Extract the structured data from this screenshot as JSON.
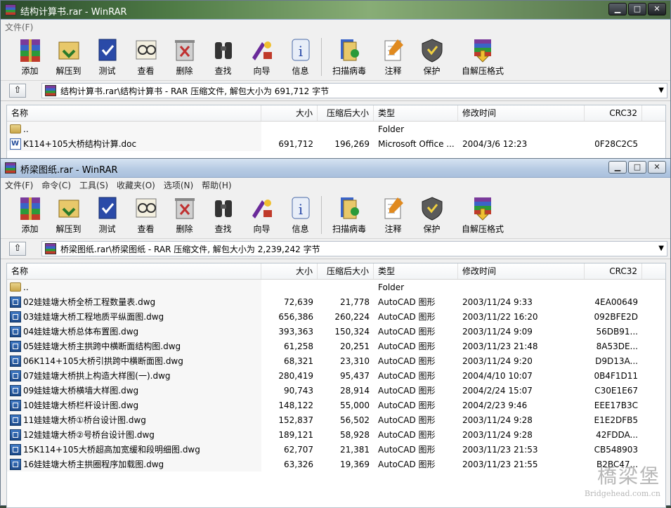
{
  "window1": {
    "title": "结构计算书.rar - WinRAR",
    "menu": [
      "文件(F)"
    ],
    "toolbar": [
      "添加",
      "解压到",
      "测试",
      "查看",
      "删除",
      "查找",
      "向导",
      "信息",
      "扫描病毒",
      "注释",
      "保护",
      "自解压格式"
    ],
    "path": "结构计算书.rar\\结构计算书 - RAR 压缩文件, 解包大小为 691,712 字节",
    "columns": [
      "名称",
      "大小",
      "压缩后大小",
      "类型",
      "修改时间",
      "CRC32"
    ],
    "rows": [
      {
        "name": "..",
        "size": "",
        "packed": "",
        "type": "Folder",
        "modified": "",
        "crc": "",
        "icon": "folder-icon"
      },
      {
        "name": "K114+105大桥结构计算.doc",
        "size": "691,712",
        "packed": "196,269",
        "type": "Microsoft Office ...",
        "modified": "2004/3/6 12:23",
        "crc": "0F28C2C5",
        "icon": "word-doc-icon"
      }
    ]
  },
  "window2": {
    "title": "桥梁图纸.rar - WinRAR",
    "menu": [
      "文件(F)",
      "命令(C)",
      "工具(S)",
      "收藏夹(O)",
      "选项(N)",
      "帮助(H)"
    ],
    "toolbar": [
      "添加",
      "解压到",
      "测试",
      "查看",
      "删除",
      "查找",
      "向导",
      "信息",
      "扫描病毒",
      "注释",
      "保护",
      "自解压格式"
    ],
    "path": "桥梁图纸.rar\\桥梁图纸 - RAR 压缩文件, 解包大小为 2,239,242 字节",
    "columns": [
      "名称",
      "大小",
      "压缩后大小",
      "类型",
      "修改时间",
      "CRC32"
    ],
    "rows": [
      {
        "name": "..",
        "size": "",
        "packed": "",
        "type": "Folder",
        "modified": "",
        "crc": "",
        "icon": "folder-icon"
      },
      {
        "name": "02娃娃塘大桥全桥工程数量表.dwg",
        "size": "72,639",
        "packed": "21,778",
        "type": "AutoCAD 图形",
        "modified": "2003/11/24 9:33",
        "crc": "4EA00649",
        "icon": "dwg-icon"
      },
      {
        "name": "03娃娃塘大桥工程地质平纵面图.dwg",
        "size": "656,386",
        "packed": "260,224",
        "type": "AutoCAD 图形",
        "modified": "2003/11/22 16:20",
        "crc": "092BFE2D",
        "icon": "dwg-icon"
      },
      {
        "name": "04娃娃塘大桥总体布置图.dwg",
        "size": "393,363",
        "packed": "150,324",
        "type": "AutoCAD 图形",
        "modified": "2003/11/24 9:09",
        "crc": "56DB91...",
        "icon": "dwg-icon"
      },
      {
        "name": "05娃娃塘大桥主拱跨中横断面结构图.dwg",
        "size": "61,258",
        "packed": "20,251",
        "type": "AutoCAD 图形",
        "modified": "2003/11/23 21:48",
        "crc": "8A53DE...",
        "icon": "dwg-icon"
      },
      {
        "name": "06K114+105大桥引拱跨中横断面图.dwg",
        "size": "68,321",
        "packed": "23,310",
        "type": "AutoCAD 图形",
        "modified": "2003/11/24 9:20",
        "crc": "D9D13A...",
        "icon": "dwg-icon"
      },
      {
        "name": "07娃娃塘大桥拱上构造大样图(一).dwg",
        "size": "280,419",
        "packed": "95,437",
        "type": "AutoCAD 图形",
        "modified": "2004/4/10 10:07",
        "crc": "0B4F1D11",
        "icon": "dwg-icon"
      },
      {
        "name": "09娃娃塘大桥横墙大样图.dwg",
        "size": "90,743",
        "packed": "28,914",
        "type": "AutoCAD 图形",
        "modified": "2004/2/24 15:07",
        "crc": "C30E1E67",
        "icon": "dwg-icon"
      },
      {
        "name": "10娃娃塘大桥栏杆设计图.dwg",
        "size": "148,122",
        "packed": "55,000",
        "type": "AutoCAD 图形",
        "modified": "2004/2/23 9:46",
        "crc": "EEE17B3C",
        "icon": "dwg-icon"
      },
      {
        "name": "11娃娃塘大桥①桥台设计图.dwg",
        "size": "152,837",
        "packed": "56,502",
        "type": "AutoCAD 图形",
        "modified": "2003/11/24 9:28",
        "crc": "E1E2DFB5",
        "icon": "dwg-icon"
      },
      {
        "name": "12娃娃塘大桥②号桥台设计图.dwg",
        "size": "189,121",
        "packed": "58,928",
        "type": "AutoCAD 图形",
        "modified": "2003/11/24 9:28",
        "crc": "42FDDA...",
        "icon": "dwg-icon"
      },
      {
        "name": "15K114+105大桥超高加宽缓和段明细图.dwg",
        "size": "62,707",
        "packed": "21,381",
        "type": "AutoCAD 图形",
        "modified": "2003/11/23 21:53",
        "crc": "CB548903",
        "icon": "dwg-icon"
      },
      {
        "name": "16娃娃塘大桥主拱圈程序加载图.dwg",
        "size": "63,326",
        "packed": "19,369",
        "type": "AutoCAD 图形",
        "modified": "2003/11/23 21:55",
        "crc": "B2BC47...",
        "icon": "dwg-icon"
      }
    ]
  },
  "watermark": {
    "cn": "橋梁堡",
    "en": "Bridgehead.com.cn"
  },
  "controls": {
    "minimize": "▁",
    "restore": "□",
    "close": "✕"
  },
  "up_glyph": "⇧",
  "drop_glyph": "▼",
  "sort_glyph": "˄",
  "colors": {
    "titlebar_active": "#b7cbe3",
    "list_bg": "#ffffff",
    "dwg_icon": "#1d4a8a"
  }
}
